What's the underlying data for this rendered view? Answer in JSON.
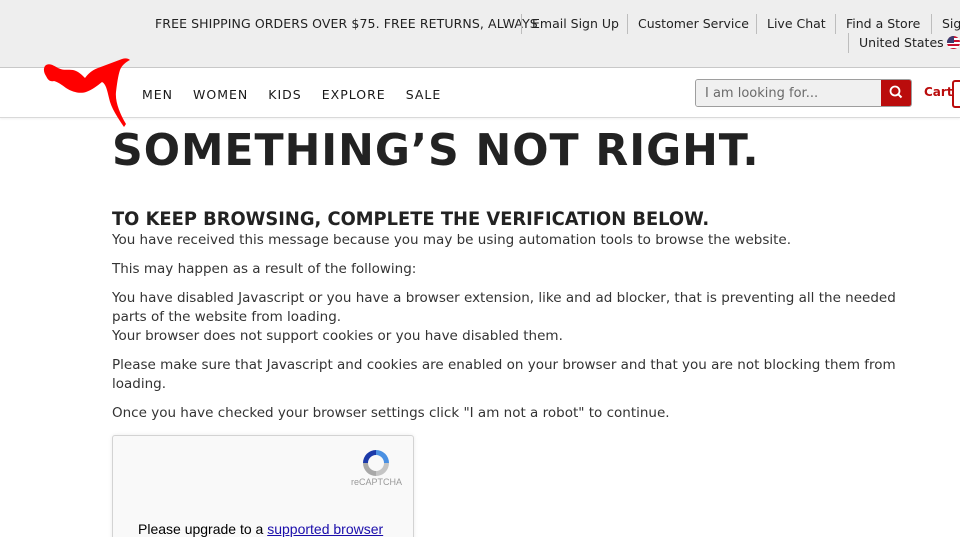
{
  "topbar": {
    "promo": "FREE SHIPPING ORDERS OVER $75. FREE RETURNS, ALWAYS",
    "links": [
      "Email Sign Up",
      "Customer Service",
      "Live Chat",
      "Find a Store",
      "Sig"
    ],
    "country": "United States"
  },
  "header": {
    "nav": [
      "MEN",
      "WOMEN",
      "KIDS",
      "EXPLORE",
      "SALE"
    ],
    "search_placeholder": "I am looking for...",
    "cart_label": "Cart",
    "brand_color": "#ba0c0c"
  },
  "content": {
    "title": "SOMETHING’S NOT RIGHT.",
    "subtitle": "TO KEEP BROWSING, COMPLETE THE VERIFICATION BELOW.",
    "p1": "You have received this message because you may be using automation tools to browse the website.",
    "p2": "This may happen as a result of the following:",
    "p3": "You have disabled Javascript or you have a browser extension, like and ad blocker, that is preventing all the needed parts of the website from loading.",
    "p4": "Your browser does not support cookies or you have disabled them.",
    "p5": "Please make sure that Javascript and cookies are enabled on your browser and that you are not blocking them from loading.",
    "p6": "Once you have checked your browser settings click \"I am not a robot\" to continue."
  },
  "captcha": {
    "brand": "reCAPTCHA",
    "message_prefix": "Please upgrade to a ",
    "message_link": "supported browser"
  }
}
